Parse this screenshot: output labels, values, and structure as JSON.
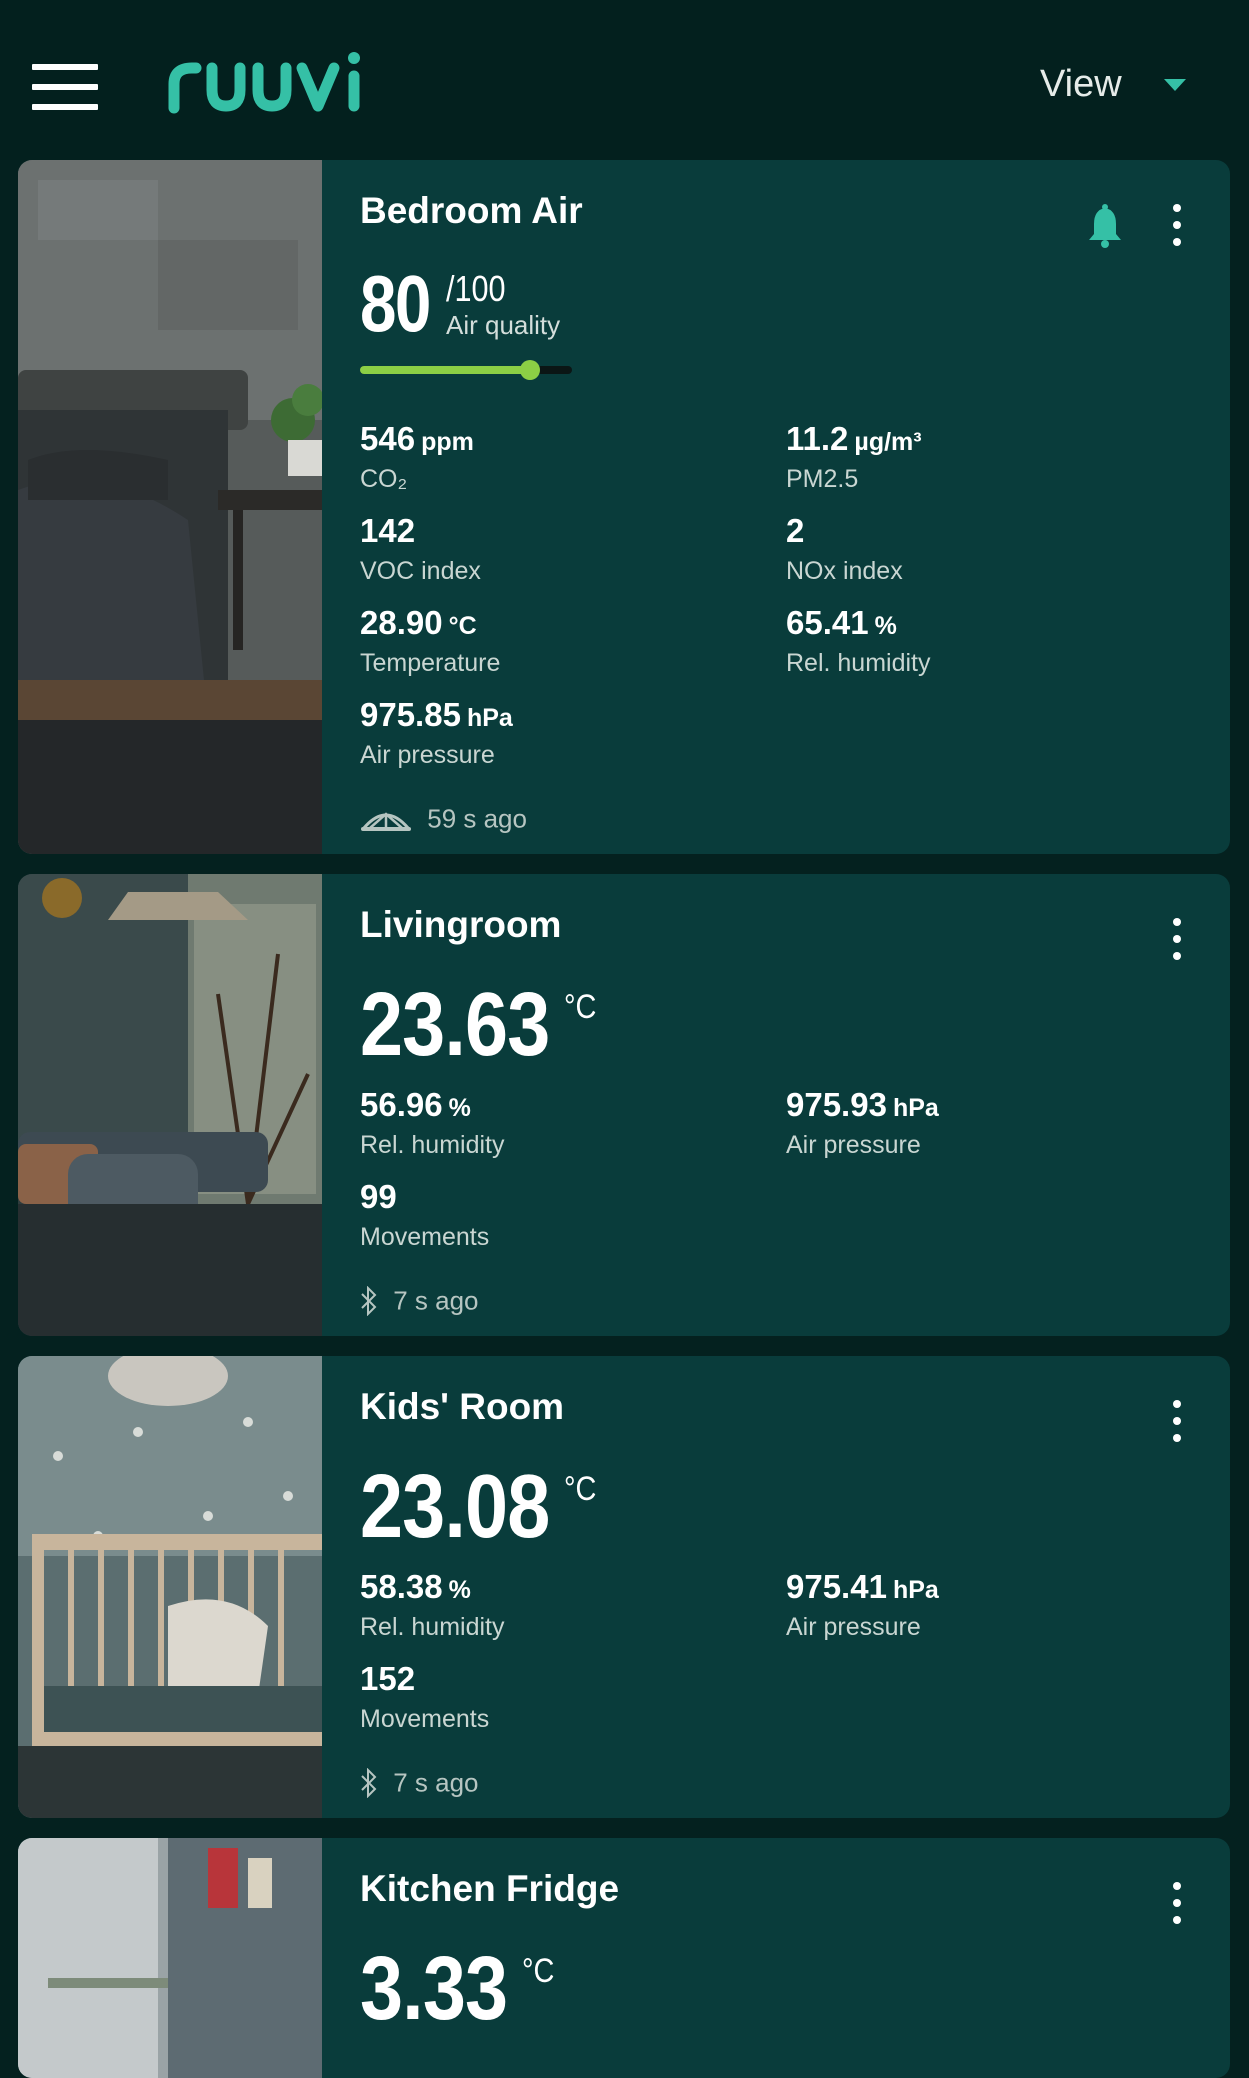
{
  "header": {
    "logo_text": "ruuvi",
    "view_label": "View"
  },
  "cards": [
    {
      "title": "Bedroom Air",
      "air_quality": {
        "value": "80",
        "max": "/100",
        "label": "Air quality",
        "score_fraction": 0.8
      },
      "metrics": [
        {
          "value": "546",
          "unit": "ppm",
          "label": "CO₂"
        },
        {
          "value": "11.2",
          "unit": "µg/m³",
          "label": "PM2.5"
        },
        {
          "value": "142",
          "unit": "",
          "label": "VOC index"
        },
        {
          "value": "2",
          "unit": "",
          "label": "NOx index"
        },
        {
          "value": "28.90",
          "unit": "°C",
          "label": "Temperature"
        },
        {
          "value": "65.41",
          "unit": "%",
          "label": "Rel. humidity"
        },
        {
          "value": "975.85",
          "unit": "hPa",
          "label": "Air pressure"
        }
      ],
      "updated": "59 s ago",
      "source_icon": "gateway-icon",
      "alert_icon": "bell-icon"
    },
    {
      "title": "Livingroom",
      "temperature": {
        "value": "23.63",
        "unit": "°C"
      },
      "metrics": [
        {
          "value": "56.96",
          "unit": "%",
          "label": "Rel. humidity"
        },
        {
          "value": "975.93",
          "unit": "hPa",
          "label": "Air pressure"
        },
        {
          "value": "99",
          "unit": "",
          "label": "Movements"
        }
      ],
      "updated": "7 s ago",
      "source_icon": "bluetooth-icon"
    },
    {
      "title": "Kids' Room",
      "temperature": {
        "value": "23.08",
        "unit": "°C"
      },
      "metrics": [
        {
          "value": "58.38",
          "unit": "%",
          "label": "Rel. humidity"
        },
        {
          "value": "975.41",
          "unit": "hPa",
          "label": "Air pressure"
        },
        {
          "value": "152",
          "unit": "",
          "label": "Movements"
        }
      ],
      "updated": "7 s ago",
      "source_icon": "bluetooth-icon"
    },
    {
      "title": "Kitchen Fridge",
      "temperature": {
        "value": "3.33",
        "unit": "°C"
      }
    }
  ],
  "colors": {
    "background": "#04211f",
    "card": "#093c3b",
    "accent": "#35c0a6",
    "air_quality_bar": "#8ccf45"
  }
}
